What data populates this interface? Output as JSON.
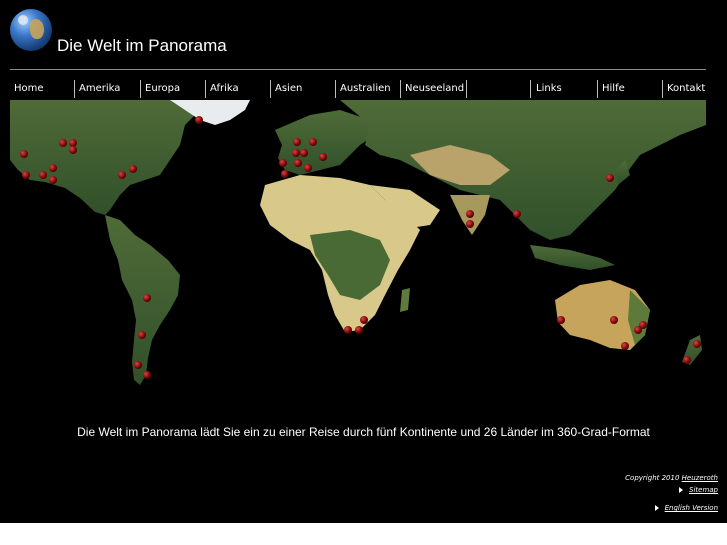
{
  "header": {
    "title": "Die Welt im Panorama",
    "logo_icon": "globe-icon"
  },
  "nav": {
    "items": [
      {
        "label": "Home"
      },
      {
        "label": "Amerika"
      },
      {
        "label": "Europa"
      },
      {
        "label": "Afrika"
      },
      {
        "label": "Asien"
      },
      {
        "label": "Australien"
      },
      {
        "label": "Neuseeland"
      },
      {
        "label": "Links"
      },
      {
        "label": "Hilfe"
      },
      {
        "label": "Kontakt"
      }
    ]
  },
  "main": {
    "caption": "Die Welt im Panorama lädt Sie ein zu einer Reise durch fünf Kontinente und 26 Länder im 360-Grad-Format"
  },
  "footer": {
    "copyright_prefix": "Copyright 2010",
    "copyright_name": "Heuzeroth",
    "sitemap_label": "Sitemap",
    "english_label": "English Version"
  },
  "colors": {
    "background": "#000000",
    "text": "#ffffff",
    "marker": "#8b0b0b",
    "ocean": "#000000"
  }
}
